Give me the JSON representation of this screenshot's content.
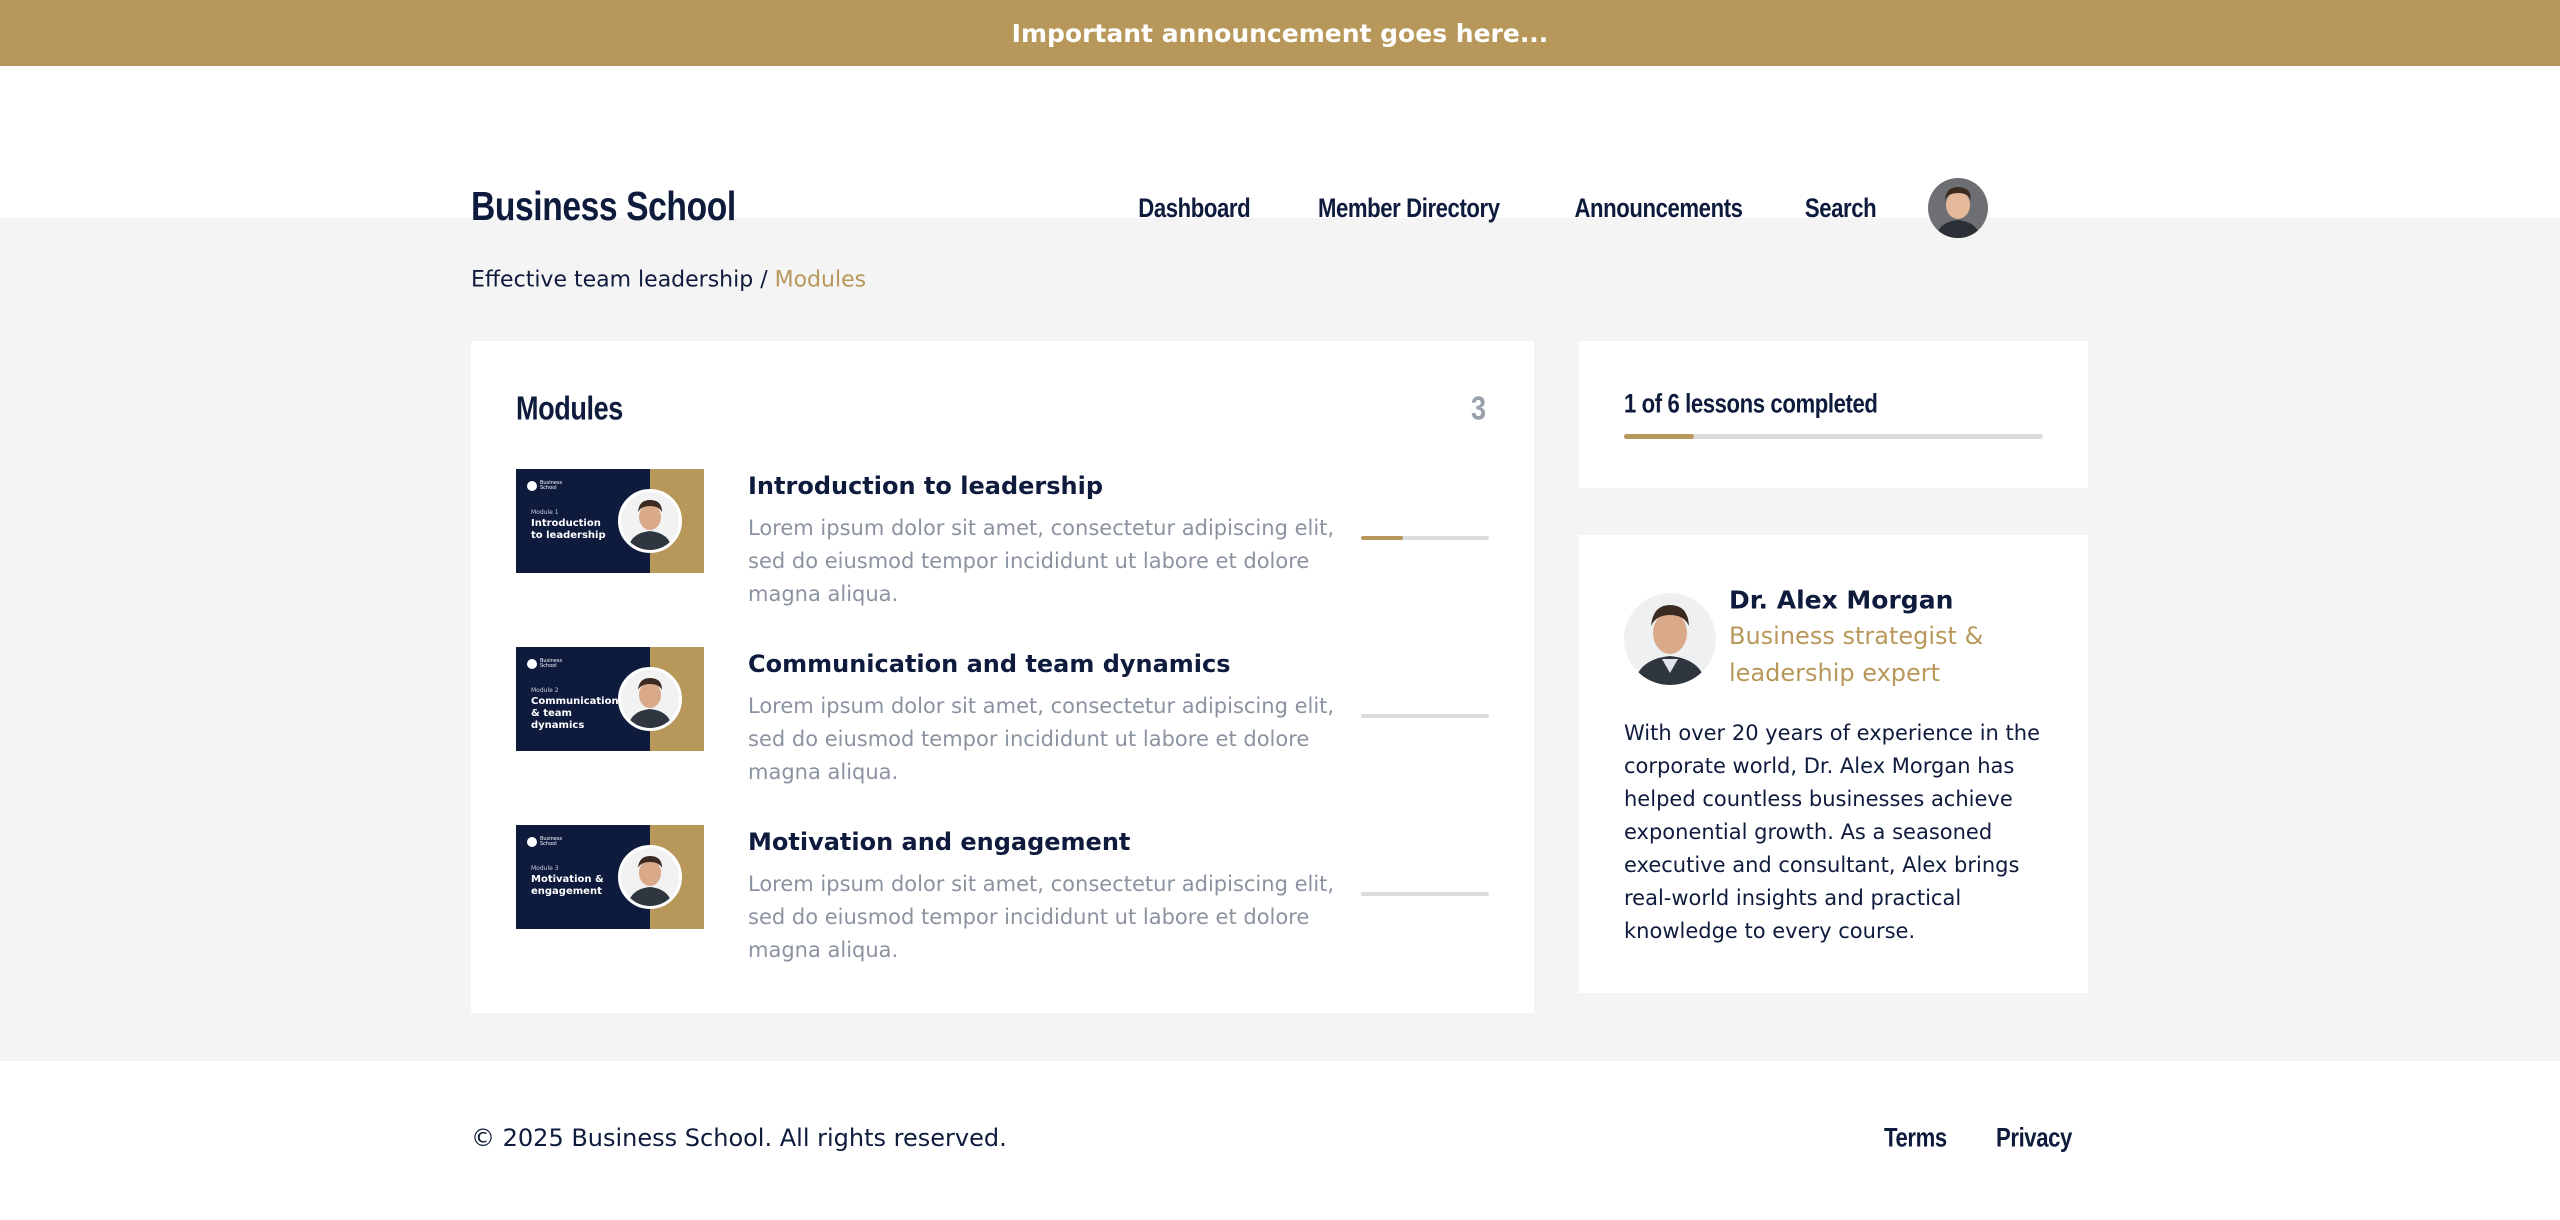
{
  "announcement": "Important announcement goes here...",
  "header": {
    "brand": "Business School",
    "nav": [
      "Dashboard",
      "Member Directory",
      "Announcements",
      "Search"
    ]
  },
  "breadcrumb": {
    "parent": "Effective team leadership",
    "separator": " / ",
    "current": "Modules"
  },
  "modules": {
    "title": "Modules",
    "count": "3",
    "items": [
      {
        "title": "Introduction to leadership",
        "thumb_label": "Module 1",
        "thumb_title": "Introduction to leadership",
        "description": "Lorem ipsum dolor sit amet, consectetur adipiscing elit, sed do eiusmod tempor incididunt ut labore et dolore magna aliqua.",
        "progress": 0.33
      },
      {
        "title": "Communication and team dynamics",
        "thumb_label": "Module 2",
        "thumb_title": "Communication & team dynamics",
        "description": "Lorem ipsum dolor sit amet, consectetur adipiscing elit, sed do eiusmod tempor incididunt ut labore et dolore magna aliqua.",
        "progress": 0
      },
      {
        "title": "Motivation and engagement",
        "thumb_label": "Module 3",
        "thumb_title": "Motivation & engagement",
        "description": "Lorem ipsum dolor sit amet, consectetur adipiscing elit, sed do eiusmod tempor incididunt ut labore et dolore magna aliqua.",
        "progress": 0
      }
    ]
  },
  "lesson_progress": {
    "label": "1 of 6 lessons completed",
    "fraction": 0.167
  },
  "instructor": {
    "name": "Dr. Alex Morgan",
    "role": "Business strategist & leadership expert",
    "bio": "With over 20 years of experience in the corporate world, Dr. Alex Morgan has helped countless businesses achieve exponential growth. As a seasoned executive and consultant, Alex brings real-world insights and practical knowledge to every course."
  },
  "footer": {
    "copyright": "© 2025 Business School. All rights reserved.",
    "links": [
      "Terms",
      "Privacy"
    ]
  },
  "colors": {
    "gold": "#b8985a",
    "navy": "#0e1b3d"
  }
}
